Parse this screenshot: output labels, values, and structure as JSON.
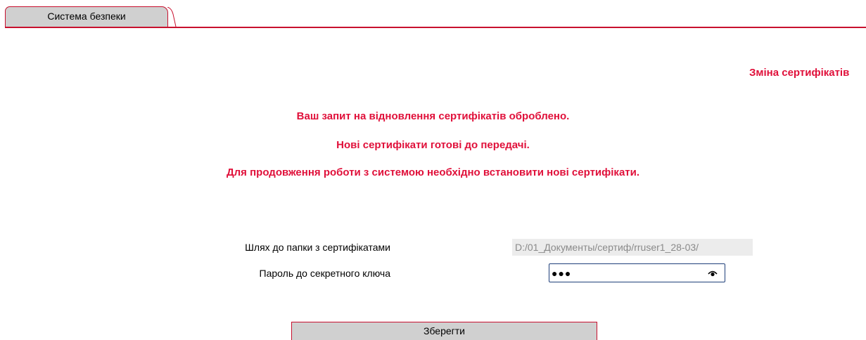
{
  "tab": {
    "label": "Система безпеки"
  },
  "page_title": "Зміна сертифікатів",
  "messages": [
    "Ваш запит на відновлення сертифікатів оброблено.",
    "Нові сертифікати готові до передачі.",
    "Для продовження роботи з системою необхідно встановити нові сертифікати."
  ],
  "form": {
    "path_label": "Шлях до папки з сертифікатами",
    "path_value": "D:/01_Документы/сертиф/rruser1_28-03/",
    "password_label": "Пароль до секретного ключа",
    "password_mask": "●●●"
  },
  "buttons": {
    "save": "Зберегти"
  },
  "icons": {
    "show_password": "eye-icon"
  },
  "colors": {
    "accent": "#c8102e",
    "message": "#e0103a",
    "input_border": "#1f3f7a"
  }
}
